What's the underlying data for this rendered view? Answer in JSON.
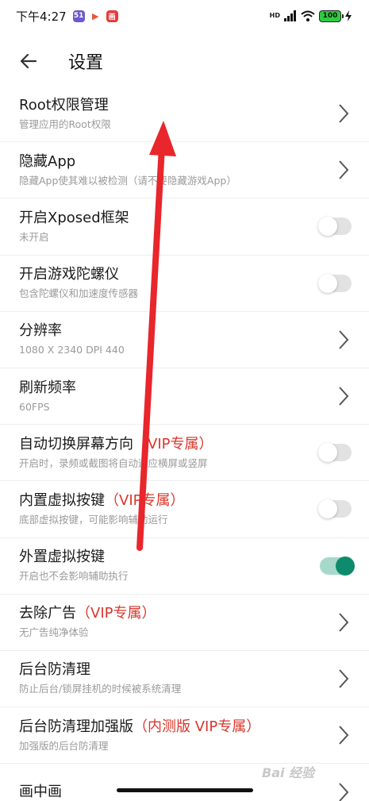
{
  "status_bar": {
    "time": "下午4:27",
    "app_icons": [
      {
        "name": "app-icon-51",
        "text": "51",
        "color": "#6a5acd"
      },
      {
        "name": "app-icon-flag",
        "text": "▶",
        "color": "#e8553b"
      },
      {
        "name": "app-icon-red",
        "text": "画",
        "color": "#e83a3a"
      }
    ],
    "network": "HD",
    "battery": "100"
  },
  "header": {
    "title": "设置"
  },
  "settings": [
    {
      "title": "Root权限管理",
      "vip": "",
      "subtitle": "管理应用的Root权限",
      "control": "chevron"
    },
    {
      "title": "隐藏App",
      "vip": "",
      "subtitle": "隐藏App使其难以被检测（请不要隐藏游戏App）",
      "control": "chevron"
    },
    {
      "title": "开启Xposed框架",
      "vip": "",
      "subtitle": "未开启",
      "control": "toggle",
      "on": false
    },
    {
      "title": "开启游戏陀螺仪",
      "vip": "",
      "subtitle": "包含陀螺仪和加速度传感器",
      "control": "toggle",
      "on": false
    },
    {
      "title": "分辨率",
      "vip": "",
      "subtitle": "1080 X 2340 DPI 440",
      "control": "chevron"
    },
    {
      "title": "刷新频率",
      "vip": "",
      "subtitle": "60FPS",
      "control": "chevron"
    },
    {
      "title": "自动切换屏幕方向",
      "vip": "（VIP专属）",
      "subtitle": "开启时，录频或截图将自动适应横屏或竖屏",
      "control": "toggle",
      "on": false
    },
    {
      "title": "内置虚拟按键",
      "vip": "（VIP专属）",
      "subtitle": "底部虚拟按键，可能影响辅助运行",
      "control": "toggle",
      "on": false
    },
    {
      "title": "外置虚拟按键",
      "vip": "",
      "subtitle": "开启也不会影响辅助执行",
      "control": "toggle",
      "on": true
    },
    {
      "title": "去除广告",
      "vip": "（VIP专属）",
      "subtitle": "无广告纯净体验",
      "control": "chevron"
    },
    {
      "title": "后台防清理",
      "vip": "",
      "subtitle": "防止后台/锁屏挂机的时候被系统清理",
      "control": "chevron"
    },
    {
      "title": "后台防清理加强版",
      "vip": "（内测版 VIP专属）",
      "subtitle": "加强版的后台防清理",
      "control": "chevron"
    },
    {
      "title": "画中画",
      "vip": "",
      "subtitle": "",
      "control": "chevron"
    }
  ],
  "colors": {
    "vip": "#d9362b",
    "toggle_on": "#0e8b6c",
    "annotation_arrow": "#e8262b"
  },
  "watermark": "Bai 经验"
}
